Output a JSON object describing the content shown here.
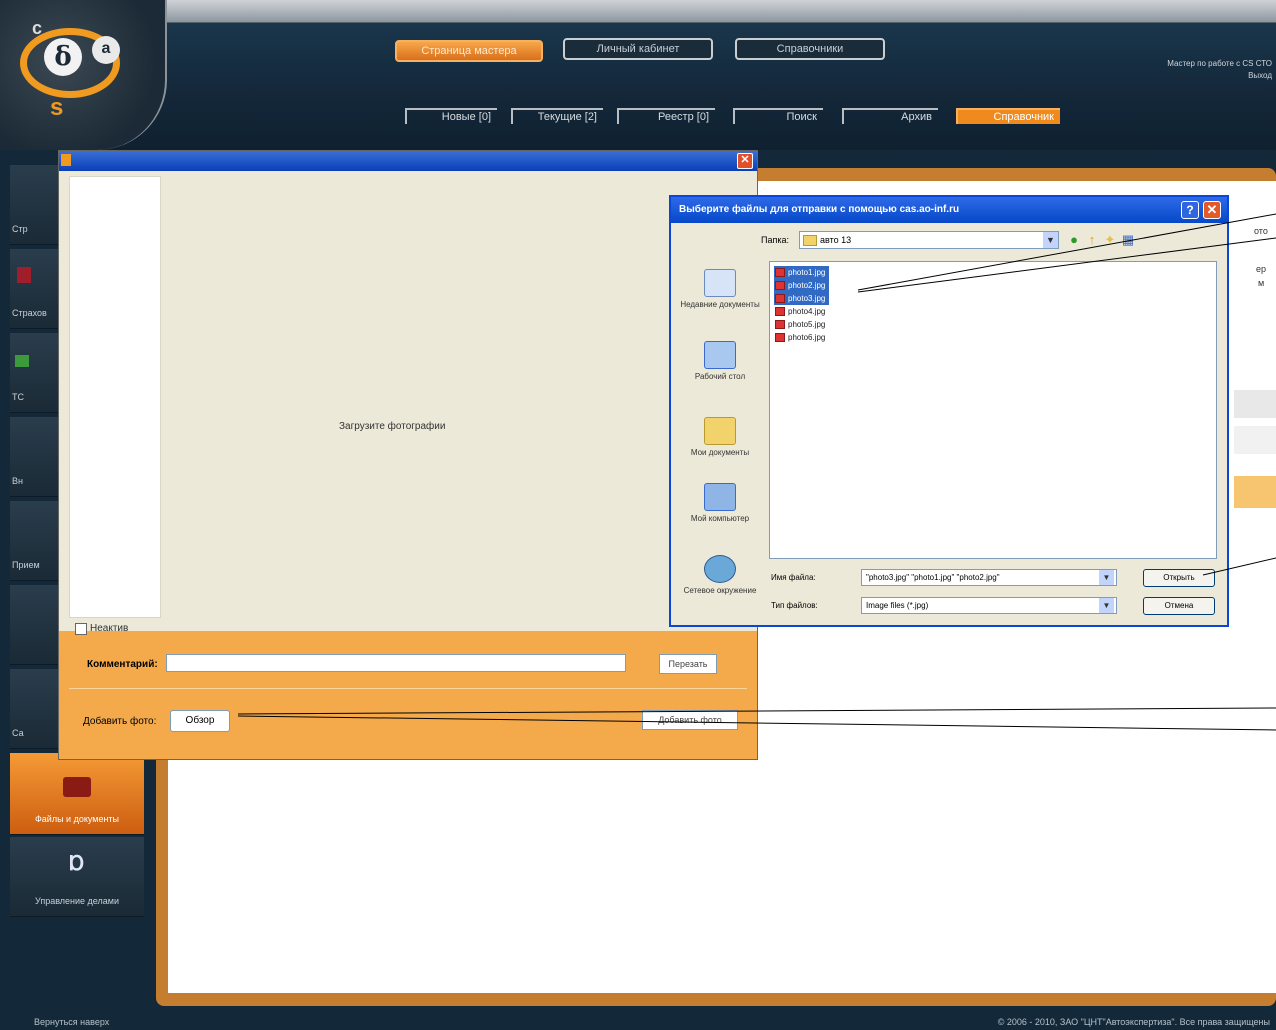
{
  "header": {
    "top_buttons": [
      "Страница мастера",
      "Личный кабинет",
      "Справочники"
    ],
    "sub_tabs": [
      "Новые [0]",
      "Текущие [2]",
      "Реестр [0]",
      "Поиск",
      "Архив",
      "Справочник"
    ],
    "user_info_line1": "Мастер по работе с CS СТО",
    "user_info_line2": "Выход"
  },
  "sidebar": {
    "items": [
      {
        "label": "Стр"
      },
      {
        "label": "Страхов"
      },
      {
        "label": "ТС"
      },
      {
        "label": "Вн"
      },
      {
        "label": "Прием"
      },
      {
        "label": ""
      },
      {
        "label": "Са"
      },
      {
        "label": "Файлы и документы"
      },
      {
        "label": "Управление делами"
      }
    ]
  },
  "content": {
    "peek_texts": [
      "ото",
      "ер",
      "м"
    ]
  },
  "upload_dialog": {
    "placeholder": "Загрузите фотографии",
    "label_checkbox": "Неактив",
    "comment_label": "Комментарий:",
    "post_button": "Перезать",
    "add_photo_label": "Добавить фото:",
    "browse_button": "Обзор",
    "add_photo_button": "Добавить фото",
    "close_glyph": "✕"
  },
  "file_dialog": {
    "title": "Выберите файлы для отправки с помощью cas.ao-inf.ru",
    "folder_label": "Папка:",
    "folder_value": "авто 13",
    "places": [
      "Недавние документы",
      "Рабочий стол",
      "Мои документы",
      "Мой компьютер",
      "Сетевое окружение"
    ],
    "files": [
      {
        "name": "photo1.jpg",
        "selected": true
      },
      {
        "name": "photo2.jpg",
        "selected": true
      },
      {
        "name": "photo3.jpg",
        "selected": true
      },
      {
        "name": "photo4.jpg",
        "selected": false
      },
      {
        "name": "photo5.jpg",
        "selected": false
      },
      {
        "name": "photo6.jpg",
        "selected": false
      }
    ],
    "filename_label": "Имя файла:",
    "filename_value": "\"photo3.jpg\" \"photo1.jpg\" \"photo2.jpg\"",
    "filetype_label": "Тип файлов:",
    "filetype_value": "Image files (*.jpg)",
    "open_button": "Открыть",
    "cancel_button": "Отмена",
    "help_glyph": "?",
    "close_glyph": "✕"
  },
  "footer": {
    "left": "Вернуться наверх",
    "right": "© 2006 - 2010, ЗАО \"ЦНТ\"Автоэкспертиза\". Все права защищены"
  },
  "colors": {
    "accent": "#f08a1c",
    "header_bg": "#14283a",
    "selection": "#316ac5",
    "dialog_panel": "#f4a94b"
  }
}
